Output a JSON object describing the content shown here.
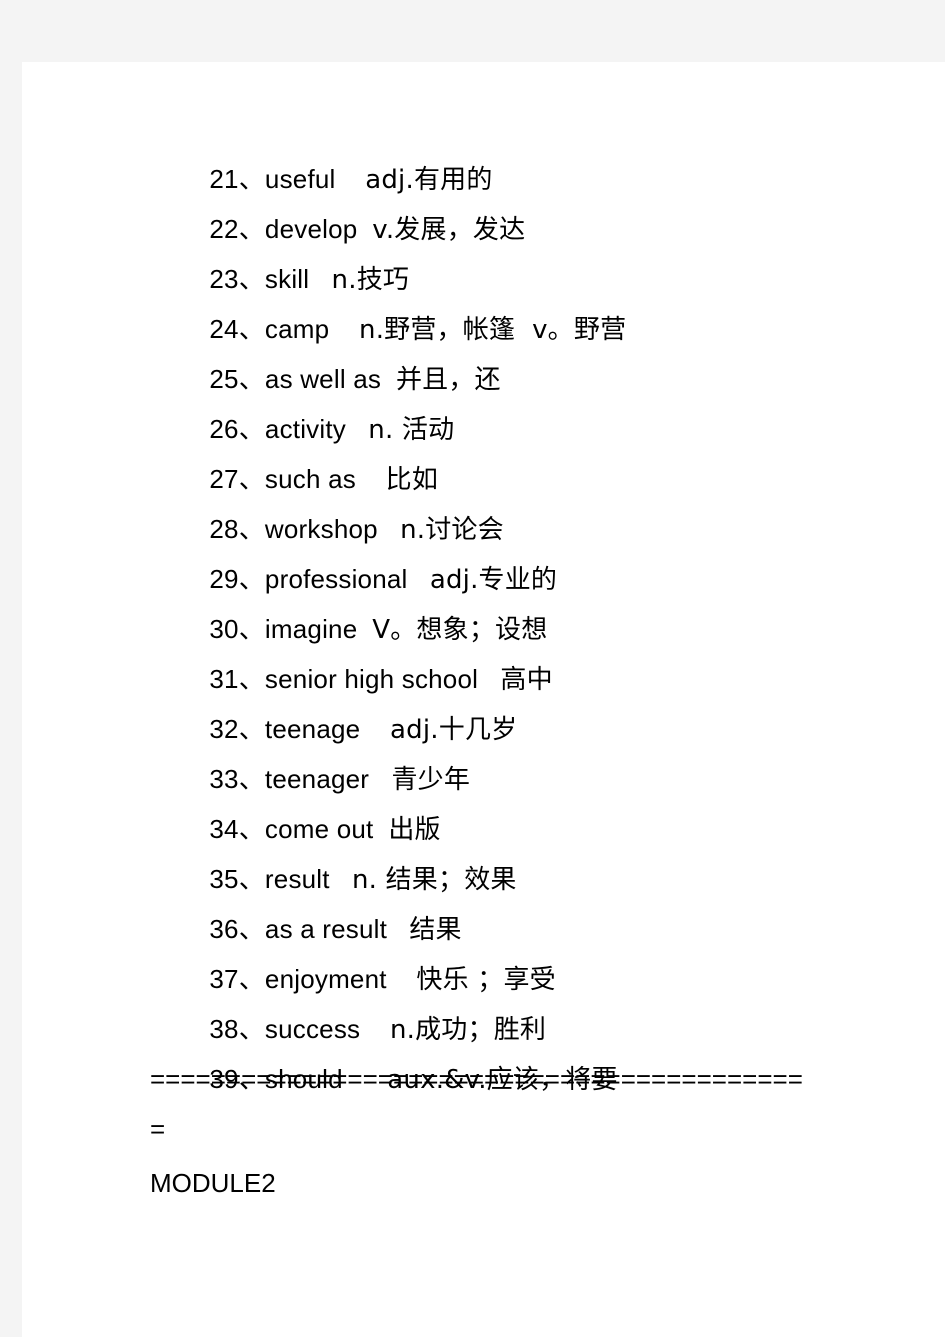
{
  "page": {
    "background_color": "#f4f4f4",
    "sheet_color": "#ffffff",
    "text_color": "#000000"
  },
  "vocabulary": {
    "entries": [
      {
        "index": "21、",
        "term": "useful",
        "gap": "    ",
        "gloss": "adj.有用的"
      },
      {
        "index": "22、",
        "term": "develop",
        "gap": "  ",
        "gloss": "v.发展，发达"
      },
      {
        "index": "23、",
        "term": "skill",
        "gap": "   ",
        "gloss": "n.技巧"
      },
      {
        "index": "24、",
        "term": "camp",
        "gap": "    ",
        "gloss": "n.野营，帐篷  v。野营"
      },
      {
        "index": "25、",
        "term": "as well as",
        "gap": "  ",
        "gloss": "并且，还"
      },
      {
        "index": "26、",
        "term": "activity",
        "gap": "   ",
        "gloss": "n. 活动"
      },
      {
        "index": "27、",
        "term": "such as",
        "gap": "    ",
        "gloss": "比如"
      },
      {
        "index": "28、",
        "term": "workshop",
        "gap": "   ",
        "gloss": "n.讨论会"
      },
      {
        "index": "29、",
        "term": "professional",
        "gap": "   ",
        "gloss": "adj.专业的"
      },
      {
        "index": "30、",
        "term": "imagine",
        "gap": "  ",
        "gloss": "V。想象；设想"
      },
      {
        "index": "31、",
        "term": "senior high school",
        "gap": "   ",
        "gloss": "高中"
      },
      {
        "index": "32、",
        "term": "teenage",
        "gap": "    ",
        "gloss": "adj.十几岁"
      },
      {
        "index": "33、",
        "term": "teenager",
        "gap": "   ",
        "gloss": "青少年"
      },
      {
        "index": "34、",
        "term": "come out",
        "gap": "  ",
        "gloss": "出版"
      },
      {
        "index": "35、",
        "term": "result",
        "gap": "   ",
        "gloss": "n. 结果；效果"
      },
      {
        "index": "36、",
        "term": "as a result",
        "gap": "   ",
        "gloss": "结果"
      },
      {
        "index": "37、",
        "term": "enjoyment",
        "gap": "    ",
        "gloss": "快乐 ；享受"
      },
      {
        "index": "38、",
        "term": "success",
        "gap": "    ",
        "gloss": "n.成功；胜利"
      },
      {
        "index": "39、",
        "term": "should",
        "gap": "      ",
        "gloss": "aux.&v.应该，将要"
      }
    ]
  },
  "separator": {
    "text": "============================================"
  },
  "section_heading": {
    "text": "MODULE2"
  }
}
